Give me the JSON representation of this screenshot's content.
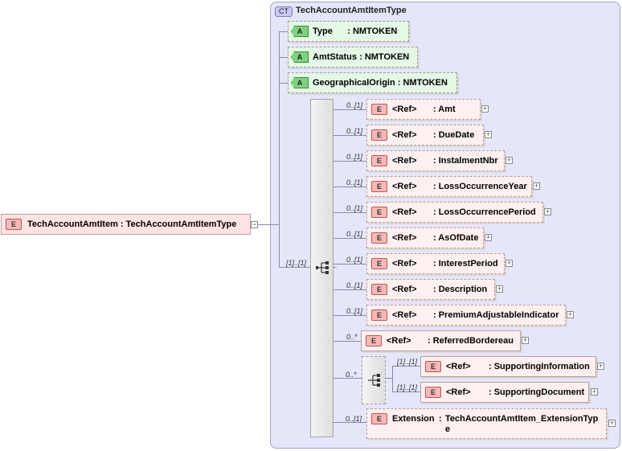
{
  "complex_type": {
    "badge": "CT",
    "name": "TechAccountAmtItemType"
  },
  "root": {
    "badge": "E",
    "label": "TechAccountAmtItem : TechAccountAmtItemType",
    "collapse": "−"
  },
  "attributes": [
    {
      "badge": "A",
      "name": "Type",
      "sep": ":",
      "type": "NMTOKEN"
    },
    {
      "badge": "A",
      "name": "AmtStatus",
      "sep": ":",
      "type": "NMTOKEN"
    },
    {
      "badge": "A",
      "name": "GeographicalOrigin",
      "sep": ":",
      "type": "NMTOKEN"
    }
  ],
  "sequence_cardinality": "[1]..[1]",
  "elements": [
    {
      "card": "0..[1]",
      "badge": "E",
      "ref": "<Ref>",
      "name": ": Amt",
      "expand": "+"
    },
    {
      "card": "0..[1]",
      "badge": "E",
      "ref": "<Ref>",
      "name": ": DueDate",
      "expand": "+"
    },
    {
      "card": "0..[1]",
      "badge": "E",
      "ref": "<Ref>",
      "name": ": InstalmentNbr",
      "expand": "+"
    },
    {
      "card": "0..[1]",
      "badge": "E",
      "ref": "<Ref>",
      "name": ": LossOccurrenceYear",
      "expand": "+"
    },
    {
      "card": "0..[1]",
      "badge": "E",
      "ref": "<Ref>",
      "name": ": LossOccurrencePeriod",
      "expand": "+"
    },
    {
      "card": "0..[1]",
      "badge": "E",
      "ref": "<Ref>",
      "name": ": AsOfDate",
      "expand": "+"
    },
    {
      "card": "0..[1]",
      "badge": "E",
      "ref": "<Ref>",
      "name": ": InterestPeriod",
      "expand": "+"
    },
    {
      "card": "0..[1]",
      "badge": "E",
      "ref": "<Ref>",
      "name": ": Description",
      "expand": "+"
    },
    {
      "card": "0..[1]",
      "badge": "E",
      "ref": "<Ref>",
      "name": ": PremiumAdjustableIndicator",
      "expand": "+"
    },
    {
      "card": "0..*",
      "badge": "E",
      "ref": "<Ref>",
      "name": ": ReferredBordereau",
      "expand": "+"
    }
  ],
  "choice": {
    "card": "0..*",
    "items": [
      {
        "card": "[1]..[1]",
        "badge": "E",
        "ref": "<Ref>",
        "name": ": SupportingInformation",
        "expand": "+"
      },
      {
        "card": "[1]..[1]",
        "badge": "E",
        "ref": "<Ref>",
        "name": ": SupportingDocument",
        "expand": "+"
      }
    ]
  },
  "extension": {
    "card": "0..[1]",
    "badge": "E",
    "name": "Extension",
    "sep": ":",
    "type_line1": "TechAccountAmtItem_ExtensionTyp",
    "type_line2": "e",
    "expand": "+"
  }
}
